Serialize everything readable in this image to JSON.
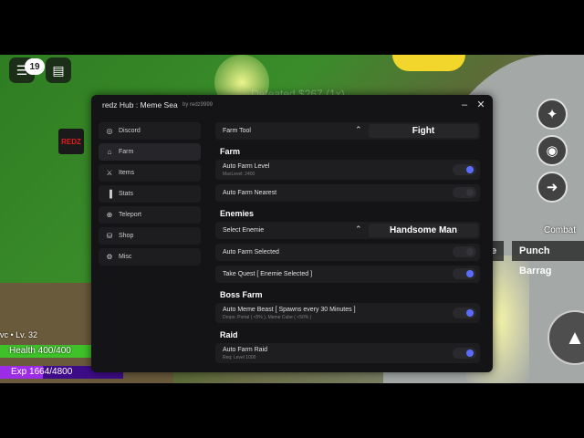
{
  "game": {
    "notification_count": "19",
    "logo_text": "REDZ",
    "bg_text_top": "Defeated $267 (1x)",
    "player": {
      "name": "vc • Lv. 32",
      "health": "Health 400/400",
      "exp": "Exp 1664/4800",
      "health_fraction": 1.0,
      "exp_fraction": 0.3467
    },
    "combat_label": "Combat",
    "skills": [
      "e",
      "Punch Barrag"
    ],
    "icons": {
      "chat": "chat-icon",
      "clipboard": "clipboard-icon",
      "sparkle": "sparkle-icon",
      "eye": "eye-icon",
      "arrow": "arrow-right-icon",
      "jump": "jump-arrow-icon"
    }
  },
  "hub": {
    "title": "redz Hub : Meme Sea",
    "subtitle": "by redz9999",
    "controls": [
      "–",
      "✕"
    ],
    "sidebar": [
      {
        "label": "Discord",
        "icon": "discord-icon",
        "glyph": "◎"
      },
      {
        "label": "Farm",
        "icon": "home-icon",
        "glyph": "⌂"
      },
      {
        "label": "Items",
        "icon": "swords-icon",
        "glyph": "⚔"
      },
      {
        "label": "Stats",
        "icon": "bars-icon",
        "glyph": "▐"
      },
      {
        "label": "Teleport",
        "icon": "compass-icon",
        "glyph": "⊕"
      },
      {
        "label": "Shop",
        "icon": "cart-icon",
        "glyph": "⛁"
      },
      {
        "label": "Misc",
        "icon": "gear-icon",
        "glyph": "⚙"
      }
    ],
    "active_tab": "Farm",
    "farm_tool": {
      "label": "Farm Tool",
      "value": "Fight"
    },
    "sections": {
      "farm": "Farm",
      "enemies": "Enemies",
      "boss_farm": "Boss Farm",
      "raid": "Raid"
    },
    "auto_farm_level": {
      "label": "Auto Farm Level",
      "desc": "MaxLevel: 2400",
      "on": true
    },
    "auto_farm_nearest": {
      "label": "Auto Farm Nearest",
      "on": false
    },
    "select_enemie": {
      "label": "Select Enemie",
      "value": "Handsome Man"
    },
    "auto_farm_selected": {
      "label": "Auto Farm Selected",
      "on": false
    },
    "take_quest": {
      "label": "Take Quest [ Enemie Selected ]",
      "on": true
    },
    "auto_meme_beast": {
      "label": "Auto Meme Beast [ Spawns every 30 Minutes ]",
      "desc": "Drops: Portal ( <5% ), Meme Cube ( <50% )",
      "on": true
    },
    "auto_farm_raid": {
      "label": "Auto Farm Raid",
      "desc": "Req: Level 1000",
      "on": true
    },
    "colors": {
      "accent": "#5a6bff",
      "panel": "#141416",
      "row": "#1e1e21"
    }
  }
}
